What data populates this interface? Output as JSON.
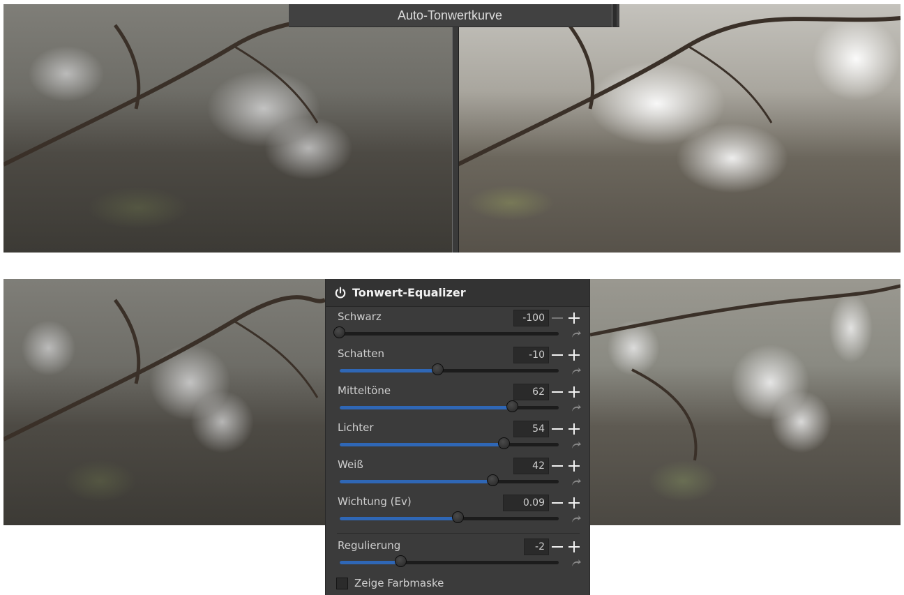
{
  "comparison": {
    "title": "Auto-Tonwertkurve"
  },
  "panel": {
    "title": "Tonwert-Equalizer",
    "icon": "power-icon",
    "sliders": [
      {
        "id": "schwarz",
        "label": "Schwarz",
        "value": "-100",
        "position": 0.0,
        "fill_from_center": false,
        "minus_dim": true
      },
      {
        "id": "schatten",
        "label": "Schatten",
        "value": "-10",
        "position": 0.45,
        "fill_from_center": false,
        "minus_dim": false
      },
      {
        "id": "mitteltoene",
        "label": "Mitteltöne",
        "value": "62",
        "position": 0.79,
        "fill_from_center": false,
        "minus_dim": false
      },
      {
        "id": "lichter",
        "label": "Lichter",
        "value": "54",
        "position": 0.75,
        "fill_from_center": false,
        "minus_dim": false
      },
      {
        "id": "weiss",
        "label": "Weiß",
        "value": "42",
        "position": 0.7,
        "fill_from_center": false,
        "minus_dim": false
      },
      {
        "id": "wichtung",
        "label": "Wichtung (Ev)",
        "value": "0.09",
        "position": 0.54,
        "fill_from_center": false,
        "minus_dim": false
      },
      {
        "id": "regulierung",
        "label": "Regulierung",
        "value": "-2",
        "position": 0.28,
        "fill_from_center": false,
        "minus_dim": false
      }
    ],
    "checkbox": {
      "label": "Zeige Farbmaske",
      "checked": false
    }
  },
  "colors": {
    "panel_bg": "#3b3b3b",
    "accent": "#2f67b6",
    "text": "#cfcfcf"
  }
}
